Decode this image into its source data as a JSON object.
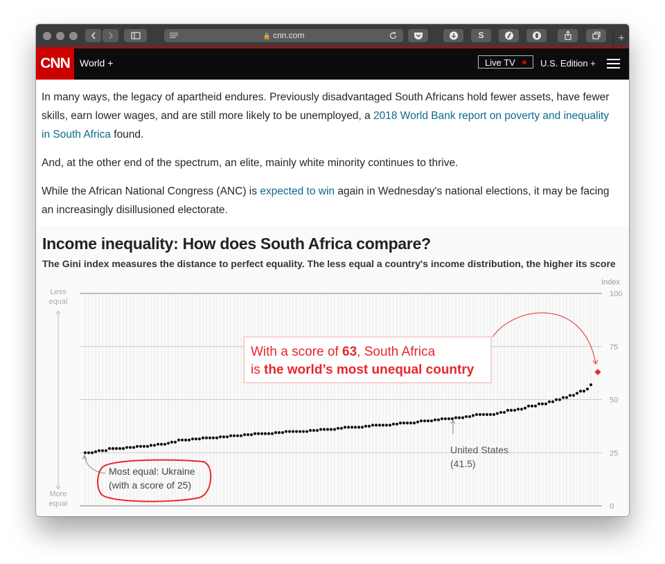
{
  "browser": {
    "url": "cnn.com",
    "icons": [
      "back-icon",
      "forward-icon",
      "sidebar-icon",
      "reader-icon",
      "lock-icon",
      "reload-icon",
      "pocket-icon",
      "download-icon",
      "s-extension-icon",
      "shield-extension-icon",
      "ghost-extension-icon",
      "share-icon",
      "tabs-icon",
      "new-tab-icon"
    ]
  },
  "header": {
    "logo": "CNN",
    "nav_world": "World +",
    "live_tv": "Live TV",
    "edition": "U.S. Edition +",
    "brand_color": "#cc0000"
  },
  "article": {
    "p1_a": "In many ways, the legacy of apartheid endures. Previously disadvantaged South Africans hold fewer assets, have fewer skills, earn lower wages, and are still more likely to be unemployed, a ",
    "p1_link": "2018 World Bank report on poverty and inequality in South Africa",
    "p1_b": " found.",
    "p2": "And, at the other end of the spectrum, an elite, mainly white minority continues to thrive.",
    "p3_a": "While the African National Congress (ANC) is ",
    "p3_link": "expected to win",
    "p3_b": " again in Wednesday's national elections, it may be facing an increasingly disillusioned electorate.",
    "link_color": "#0c6a8f"
  },
  "graphic": {
    "title": "Income inequality: How does South Africa compare?",
    "subtitle": "The Gini index measures the distance to perfect equality. The less equal a country's income distribution, the higher its score",
    "axis_title": "Index",
    "less_label": [
      "Less",
      "equal"
    ],
    "more_label": [
      "More",
      "equal"
    ],
    "callout_sa_1a": "With a score of ",
    "callout_sa_1b": "63",
    "callout_sa_1c": ", South Africa",
    "callout_sa_2a": "is ",
    "callout_sa_2b": "the world’s most unequal country",
    "callout_us_1": "United States",
    "callout_us_2": "(41.5)",
    "callout_ua_1": "Most equal: Ukraine",
    "callout_ua_2": "(with a score of 25)",
    "highlight_color": "#e8262d"
  },
  "chart_data": {
    "type": "scatter",
    "title": "Income inequality: How does South Africa compare?",
    "ylabel": "Index",
    "yticks": [
      0,
      25,
      50,
      75,
      100
    ],
    "ylim": [
      0,
      100
    ],
    "grid": true,
    "x_description": "countries sorted by Gini index",
    "points": [
      25,
      25,
      25,
      25.5,
      26,
      26,
      26,
      27,
      27,
      27,
      27,
      27,
      27.5,
      27.5,
      27.5,
      28,
      28,
      28,
      28,
      28.5,
      28.5,
      29,
      29,
      29,
      29.5,
      30,
      30,
      31,
      31,
      31,
      31,
      31.5,
      31.5,
      31.5,
      32,
      32,
      32,
      32,
      32,
      32.5,
      32.5,
      32.5,
      33,
      33,
      33,
      33,
      33.5,
      33.5,
      33.5,
      34,
      34,
      34,
      34,
      34,
      34,
      34.5,
      34.5,
      34.5,
      35,
      35,
      35,
      35,
      35,
      35,
      35,
      35.5,
      35.5,
      35.5,
      36,
      36,
      36,
      36,
      36,
      36.5,
      36.5,
      37,
      37,
      37,
      37,
      37,
      37,
      37.5,
      37.5,
      38,
      38,
      38,
      38,
      38,
      38,
      38.5,
      38.5,
      39,
      39,
      39,
      39,
      39,
      39.5,
      40,
      40,
      40,
      40,
      40.5,
      40.5,
      41,
      41,
      41,
      41,
      41.5,
      41.5,
      41.5,
      42,
      42,
      42.5,
      43,
      43,
      43,
      43,
      43,
      43,
      43.5,
      44,
      44,
      45,
      45,
      45,
      45.5,
      45.5,
      46,
      47,
      47,
      47,
      48,
      48,
      48,
      49,
      49,
      50,
      50,
      51,
      51,
      52,
      52,
      53,
      54,
      54,
      55,
      57
    ],
    "highlights": [
      {
        "label": "South Africa",
        "value": 63
      },
      {
        "label": "United States",
        "value": 41.5
      },
      {
        "label": "Ukraine",
        "value": 25
      }
    ]
  }
}
